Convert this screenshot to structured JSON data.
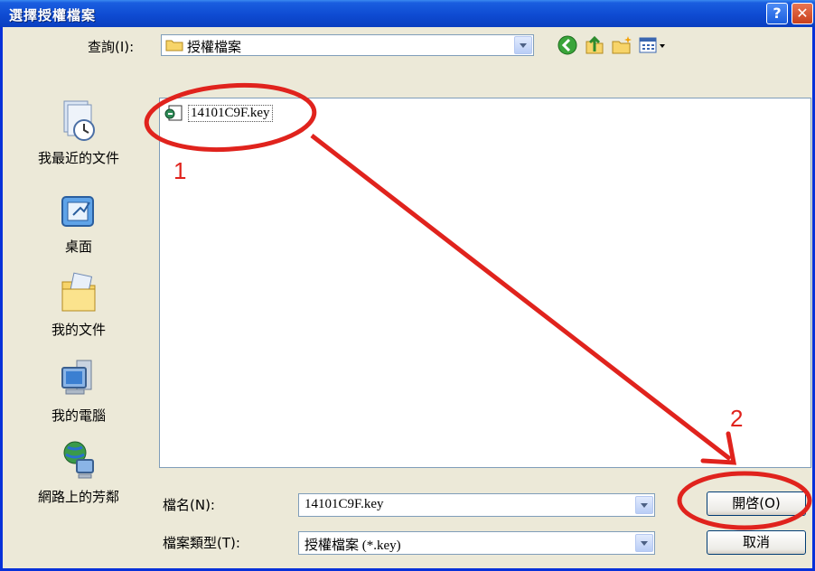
{
  "window": {
    "title": "選擇授權檔案",
    "help_label": "?",
    "close_label": "✕"
  },
  "lookin": {
    "label": "查詢(I):",
    "folder": "授權檔案"
  },
  "places": [
    {
      "label": "我最近的文件",
      "icon": "recent-documents-icon"
    },
    {
      "label": "桌面",
      "icon": "desktop-icon"
    },
    {
      "label": "我的文件",
      "icon": "my-documents-icon"
    },
    {
      "label": "我的電腦",
      "icon": "my-computer-icon"
    },
    {
      "label": "網路上的芳鄰",
      "icon": "network-places-icon"
    }
  ],
  "files": [
    {
      "name": "14101C9F.key",
      "icon": "key-file-icon"
    }
  ],
  "filename": {
    "label": "檔名(N):",
    "value": "14101C9F.key"
  },
  "filetype": {
    "label": "檔案類型(T):",
    "value": "授權檔案 (*.key)"
  },
  "buttons": {
    "open": "開啓(O)",
    "cancel": "取消"
  },
  "annotations": {
    "step1": "1",
    "step2": "2",
    "color": "#e0231d"
  }
}
